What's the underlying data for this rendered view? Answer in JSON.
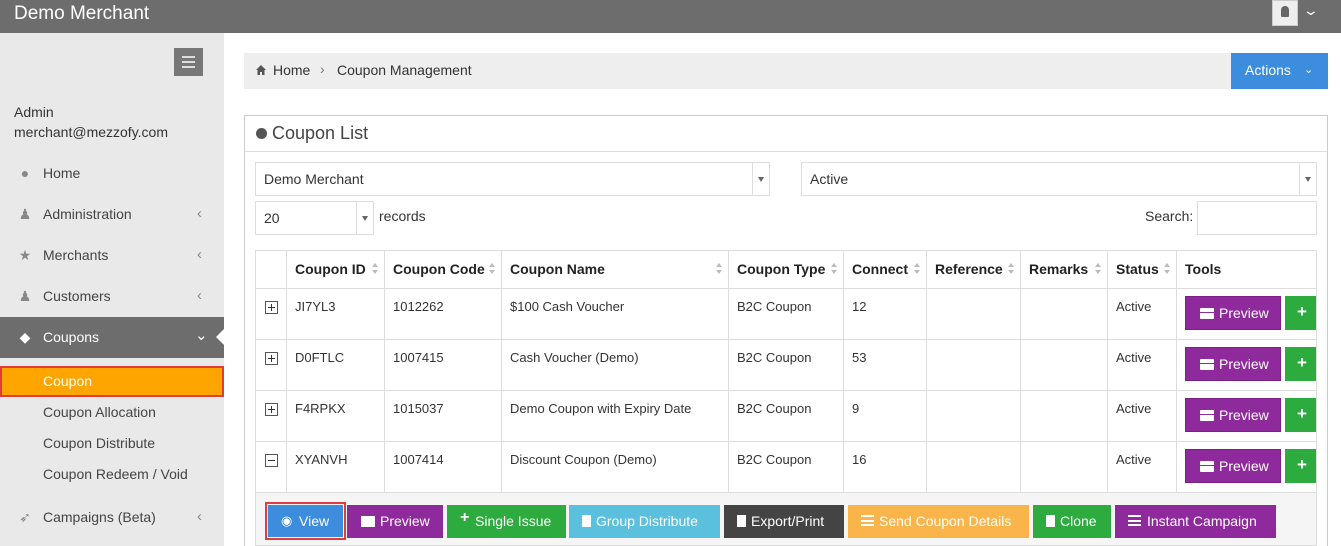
{
  "topbar": {
    "title": "Demo Merchant"
  },
  "sidebar": {
    "user_role": "Admin",
    "user_email": "merchant@mezzofy.com",
    "items": [
      {
        "label": "Home",
        "icon": "globe-icon",
        "has_arrow": false
      },
      {
        "label": "Administration",
        "icon": "user-icon",
        "has_arrow": true
      },
      {
        "label": "Merchants",
        "icon": "star-icon",
        "has_arrow": true
      },
      {
        "label": "Customers",
        "icon": "users-icon",
        "has_arrow": true
      },
      {
        "label": "Coupons",
        "icon": "tag-icon",
        "has_arrow": true,
        "active": true
      },
      {
        "label": "Campaigns (Beta)",
        "icon": "rocket-icon",
        "has_arrow": true
      }
    ],
    "subitems": [
      {
        "label": "Coupon",
        "current": true
      },
      {
        "label": "Coupon Allocation"
      },
      {
        "label": "Coupon Distribute"
      },
      {
        "label": "Coupon Redeem / Void"
      }
    ]
  },
  "breadcrumb": {
    "home": "Home",
    "sep": "›",
    "current": "Coupon Management"
  },
  "actions_label": "Actions",
  "panel": {
    "title": "Coupon List",
    "merchant_select": "Demo Merchant",
    "status_select": "Active",
    "page_size": "20",
    "records_label": "records",
    "search_label": "Search:"
  },
  "table": {
    "headers": [
      "Coupon ID",
      "Coupon Code",
      "Coupon Name",
      "Coupon Type",
      "Connect",
      "Reference",
      "Remarks",
      "Status",
      "Tools"
    ],
    "rows": [
      {
        "id": "JI7YL3",
        "code": "1012262",
        "name": "$100 Cash Voucher",
        "type": "B2C Coupon",
        "connect": "12",
        "reference": "",
        "remarks": "",
        "status": "Active",
        "expanded": false
      },
      {
        "id": "D0FTLC",
        "code": "1007415",
        "name": "Cash Voucher (Demo)",
        "type": "B2C Coupon",
        "connect": "53",
        "reference": "",
        "remarks": "",
        "status": "Active",
        "expanded": false
      },
      {
        "id": "F4RPKX",
        "code": "1015037",
        "name": "Demo Coupon with Expiry Date",
        "type": "B2C Coupon",
        "connect": "9",
        "reference": "",
        "remarks": "",
        "status": "Active",
        "expanded": false
      },
      {
        "id": "XYANVH",
        "code": "1007414",
        "name": "Discount Coupon (Demo)",
        "type": "B2C Coupon",
        "connect": "16",
        "reference": "",
        "remarks": "",
        "status": "Active",
        "expanded": true
      }
    ],
    "preview_label": "Preview"
  },
  "detail_actions": [
    {
      "label": "View",
      "icon": "eye-icon",
      "color": "#3c8dde"
    },
    {
      "label": "Preview",
      "icon": "briefcase-icon",
      "color": "#8e2a9b"
    },
    {
      "label": "Single Issue",
      "icon": "plus-icon",
      "color": "#2dab3f"
    },
    {
      "label": "Group Distribute",
      "icon": "file-icon",
      "color": "#5bc0de"
    },
    {
      "label": "Export/Print",
      "icon": "file-icon",
      "color": "#444444"
    },
    {
      "label": "Send Coupon Details",
      "icon": "list-icon",
      "color": "#f9b44a"
    },
    {
      "label": "Clone",
      "icon": "file-icon",
      "color": "#2dab3f"
    },
    {
      "label": "Instant Campaign",
      "icon": "list-icon",
      "color": "#8e2a9b"
    }
  ]
}
